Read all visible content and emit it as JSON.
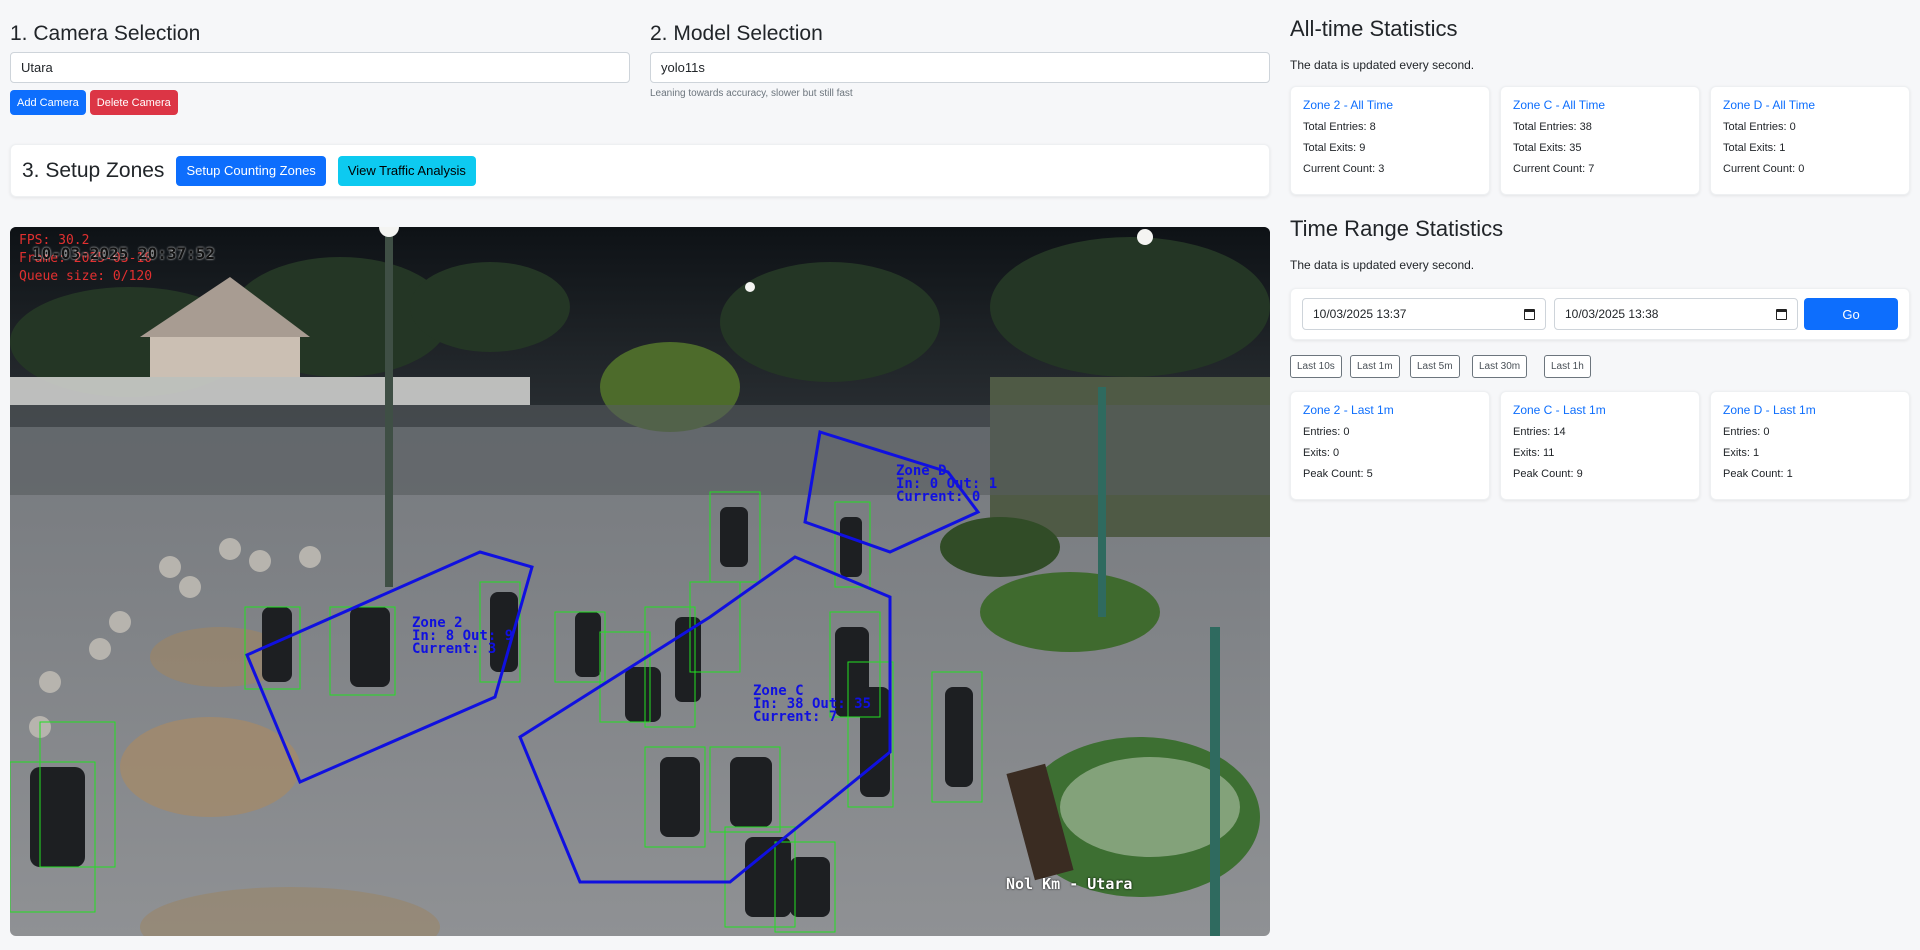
{
  "camera": {
    "title": "1. Camera Selection",
    "selected": "Utara",
    "add_label": "Add Camera",
    "delete_label": "Delete Camera"
  },
  "model": {
    "title": "2. Model Selection",
    "selected": "yolo11s",
    "hint": "Leaning towards accuracy, slower but still fast"
  },
  "zones_setup": {
    "title": "3. Setup Zones",
    "setup_label": "Setup Counting Zones",
    "traffic_label": "View Traffic Analysis"
  },
  "video": {
    "overlay_fps": "FPS: 30.2",
    "overlay_frame": "Frame: 2025-03-10",
    "overlay_queue": "Queue size: 0/120",
    "timestamp": "10-03-2025 20:37:52",
    "camera_label": "Nol Km - Utara",
    "zones": [
      {
        "name": "Zone 2",
        "stats": "In: 8 Out: 9",
        "current": "Current: 3"
      },
      {
        "name": "Zone C",
        "stats": "In: 38 Out: 35",
        "current": "Current: 7"
      },
      {
        "name": "Zone D",
        "stats": "In: 0 Out: 1",
        "current": "Current: 0"
      }
    ],
    "zone_color": "#1010e0",
    "box_color": "#22e022"
  },
  "alltime": {
    "title": "All-time Statistics",
    "subtitle": "The data is updated every second.",
    "cards": [
      {
        "title": "Zone 2 - All Time",
        "entries": "Total Entries: 8",
        "exits": "Total Exits: 9",
        "current": "Current Count: 3"
      },
      {
        "title": "Zone C - All Time",
        "entries": "Total Entries: 38",
        "exits": "Total Exits: 35",
        "current": "Current Count: 7"
      },
      {
        "title": "Zone D - All Time",
        "entries": "Total Entries: 0",
        "exits": "Total Exits: 1",
        "current": "Current Count: 0"
      }
    ]
  },
  "timerange": {
    "title": "Time Range Statistics",
    "subtitle": "The data is updated every second.",
    "start": "10/03/2025 13:37",
    "end": "10/03/2025 13:38",
    "go_label": "Go",
    "quick": [
      "Last 10s",
      "Last 1m",
      "Last 5m",
      "Last 30m",
      "Last 1h"
    ],
    "cards": [
      {
        "title": "Zone 2 - Last 1m",
        "entries": "Entries: 0",
        "exits": "Exits: 0",
        "peak": "Peak Count: 5"
      },
      {
        "title": "Zone C - Last 1m",
        "entries": "Entries: 14",
        "exits": "Exits: 11",
        "peak": "Peak Count: 9"
      },
      {
        "title": "Zone D - Last 1m",
        "entries": "Entries: 0",
        "exits": "Exits: 1",
        "peak": "Peak Count: 1"
      }
    ]
  },
  "colors": {
    "primary": "#0d6efd",
    "danger": "#dc3545",
    "info": "#0dcaf0",
    "background": "#f6f7f9"
  }
}
